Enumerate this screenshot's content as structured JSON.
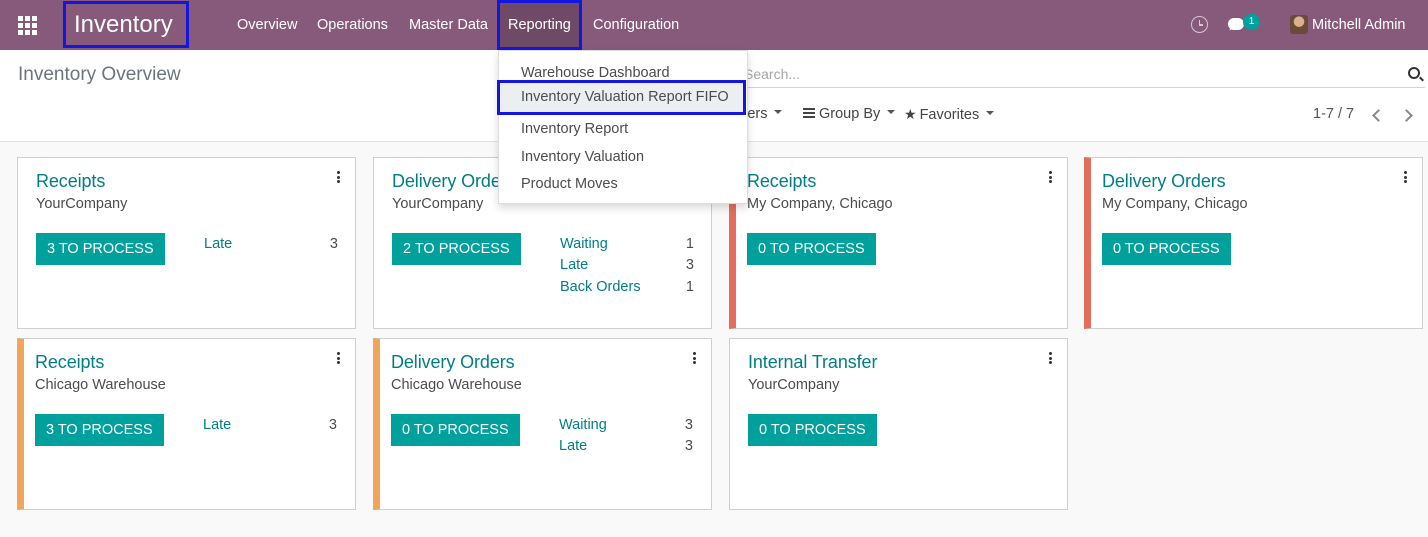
{
  "navbar": {
    "app_title": "Inventory",
    "menu": [
      "Overview",
      "Operations",
      "Master Data",
      "Reporting",
      "Configuration"
    ],
    "chat_count": "1",
    "user_name": "Mitchell Admin",
    "icons": [
      "apps-grid-icon",
      "clock-icon",
      "chat-icon",
      "avatar"
    ]
  },
  "control_panel": {
    "title": "Inventory Overview",
    "search_placeholder": "Search...",
    "filters_label": "Filters",
    "group_by_label": "Group By",
    "favorites_label": "Favorites",
    "pager": "1-7 / 7"
  },
  "reporting_menu": {
    "items": [
      "Warehouse Dashboard",
      "Inventory Valuation Report FIFO",
      "Inventory Report",
      "Inventory Valuation",
      "Product Moves"
    ],
    "highlighted": "Inventory Valuation Report FIFO"
  },
  "cards": [
    {
      "title": "Receipts",
      "subtitle": "YourCompany",
      "button": "3 TO PROCESS",
      "stats": [
        {
          "label": "Late",
          "count": "3"
        }
      ]
    },
    {
      "title": "Delivery Orders",
      "subtitle": "YourCompany",
      "button": "2 TO PROCESS",
      "stats": [
        {
          "label": "Waiting",
          "count": "1"
        },
        {
          "label": "Late",
          "count": "3"
        },
        {
          "label": "Back Orders",
          "count": "1"
        }
      ]
    },
    {
      "title": "Receipts",
      "subtitle": "My Company, Chicago",
      "button": "0 TO PROCESS",
      "stats": [],
      "accent": "#e46e5b"
    },
    {
      "title": "Delivery Orders",
      "subtitle": "My Company, Chicago",
      "button": "0 TO PROCESS",
      "stats": [],
      "accent": "#e46e5b"
    },
    {
      "title": "Receipts",
      "subtitle": "Chicago Warehouse",
      "button": "3 TO PROCESS",
      "stats": [
        {
          "label": "Late",
          "count": "3"
        }
      ],
      "accent": "#f0a55b"
    },
    {
      "title": "Delivery Orders",
      "subtitle": "Chicago Warehouse",
      "button": "0 TO PROCESS",
      "stats": [
        {
          "label": "Waiting",
          "count": "3"
        },
        {
          "label": "Late",
          "count": "3"
        }
      ],
      "accent": "#f0a55b"
    },
    {
      "title": "Internal Transfer",
      "subtitle": "YourCompany",
      "button": "0 TO PROCESS",
      "stats": []
    }
  ],
  "colors": {
    "navbar": "#875a7b",
    "primary_button": "#00a09d",
    "link": "#017e84",
    "highlight_box": "#1515e0"
  }
}
